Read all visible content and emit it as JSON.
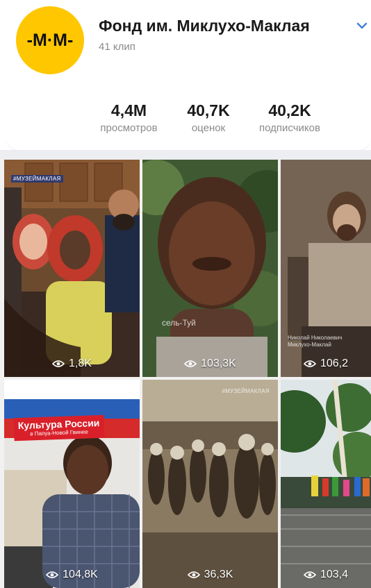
{
  "channel": {
    "logo_text": "-М·М-",
    "name": "Фонд им. Миклухо-Маклая",
    "clips_count": "41 клип"
  },
  "stats": [
    {
      "value": "4,4M",
      "label": "просмотров"
    },
    {
      "value": "40,7K",
      "label": "оценок"
    },
    {
      "value": "40,2K",
      "label": "подписчиков"
    }
  ],
  "clips": [
    {
      "views": "1,8K",
      "tag": "#МУЗЕЙМАКЛАЯ"
    },
    {
      "views": "103,3K",
      "overlay": "сель-Туй"
    },
    {
      "views": "106,2",
      "caption": "Николай Николаевич Миклухо-Маклай"
    },
    {
      "views": "104,8K",
      "banner_title": "Культура России",
      "banner_subtitle": "в Папуа-Новой Гвинее"
    },
    {
      "views": "36,3K",
      "tag": "#МУЗЕЙМАКЛАЯ"
    },
    {
      "views": "103,4"
    }
  ],
  "colors": {
    "logo": "#ffc700",
    "chevron": "#3f7fd9",
    "text_secondary": "#8a8a8a"
  }
}
